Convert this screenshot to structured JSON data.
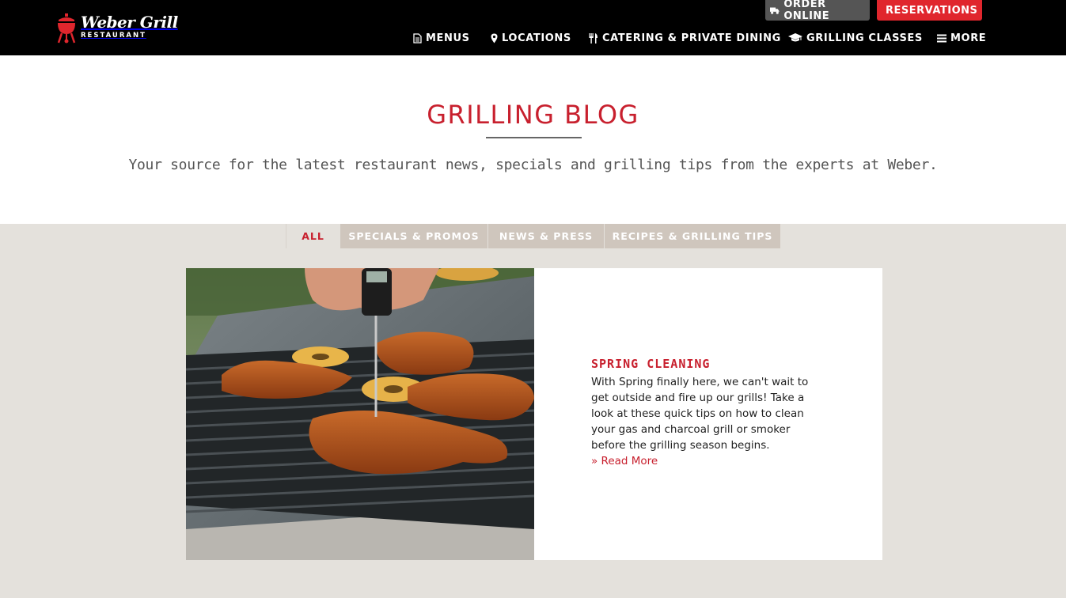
{
  "header": {
    "logo": {
      "brand": "Weber Grill",
      "sub": "RESTAURANT"
    },
    "cta": {
      "order_label": "ORDER ONLINE",
      "reservations_label": "RESERVATIONS"
    },
    "nav": [
      {
        "label": "MENUS",
        "icon": "document-icon"
      },
      {
        "label": "LOCATIONS",
        "icon": "map-pin-icon"
      },
      {
        "label": "CATERING & PRIVATE DINING",
        "icon": "utensils-icon"
      },
      {
        "label": "GRILLING CLASSES",
        "icon": "graduation-cap-icon"
      },
      {
        "label": "MORE",
        "icon": "hamburger-icon"
      }
    ]
  },
  "intro": {
    "title": "GRILLING BLOG",
    "tagline": "Your source for the latest restaurant news, specials and grilling tips from the experts at Weber."
  },
  "tabs": [
    {
      "label": "ALL",
      "active": true
    },
    {
      "label": "SPECIALS & PROMOS",
      "active": false
    },
    {
      "label": "NEWS & PRESS",
      "active": false
    },
    {
      "label": "RECIPES & GRILLING TIPS",
      "active": false
    }
  ],
  "post": {
    "title": "SPRING CLEANING",
    "excerpt": "With Spring finally here, we can't wait to get outside and fire up our grills! Take a look at these quick tips on how to clean your gas and charcoal grill or smoker before the grilling season begins.",
    "read_more": "» Read More",
    "image_alt": "grilled chicken on grill with thermometer"
  },
  "colors": {
    "brand_red": "#c8202e",
    "cta_red": "#e0262d",
    "header_bg": "#000000",
    "page_bg": "#e4e1dc",
    "tab_bg": "#cfc6bd"
  }
}
